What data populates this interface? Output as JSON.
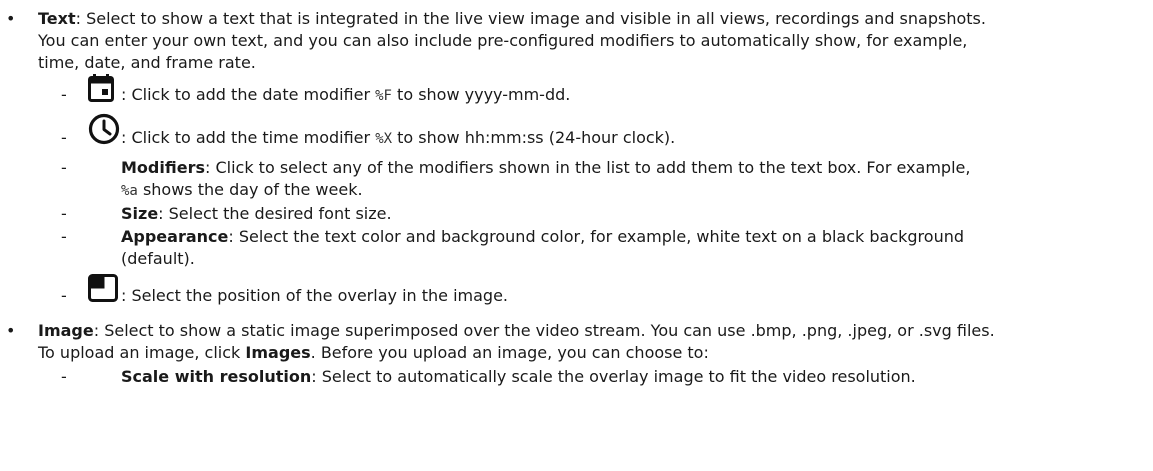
{
  "text_item": {
    "bullet": "•",
    "title": "Text",
    "line1": ": Select to show a text that is integrated in the live view image and visible in all views, recordings and snapshots.",
    "line2": "You can enter your own text, and you can also include pre-configured modifiers to automatically show, for example,",
    "line3": "time, date, and frame rate.",
    "subitems": {
      "date": {
        "icon": "calendar-icon",
        "text_before": ": Click to add the date modifier ",
        "code": "%F",
        "text_after": " to show yyyy-mm-dd."
      },
      "time": {
        "icon": "clock-icon",
        "text_before": ": Click to add the time modifier ",
        "code": "%X",
        "text_after": " to show hh:mm:ss (24-hour clock)."
      },
      "modifiers": {
        "title": "Modifiers",
        "line1": ": Click to select any of the modifiers shown in the list to add them to the text box. For example,",
        "code": "%a",
        "line2_after": " shows the day of the week."
      },
      "size": {
        "title": "Size",
        "text": ": Select the desired font size."
      },
      "appearance": {
        "title": "Appearance",
        "line1": ": Select the text color and background color, for example, white text on a black background",
        "line2": "(default)."
      },
      "position": {
        "icon": "position-icon",
        "text": ": Select the position of the overlay in the image."
      }
    }
  },
  "image_item": {
    "bullet": "•",
    "title": "Image",
    "line1": ": Select to show a static image superimposed over the video stream. You can use .bmp, .png, .jpeg, or .svg files.",
    "line2_before": "To upload an image, click ",
    "line2_bold": "Images",
    "line2_after": ". Before you upload an image, you can choose to:",
    "subitems": {
      "scale": {
        "title": "Scale with resolution",
        "text": ": Select to automatically scale the overlay image to fit the video resolution."
      }
    }
  },
  "dash": "-"
}
